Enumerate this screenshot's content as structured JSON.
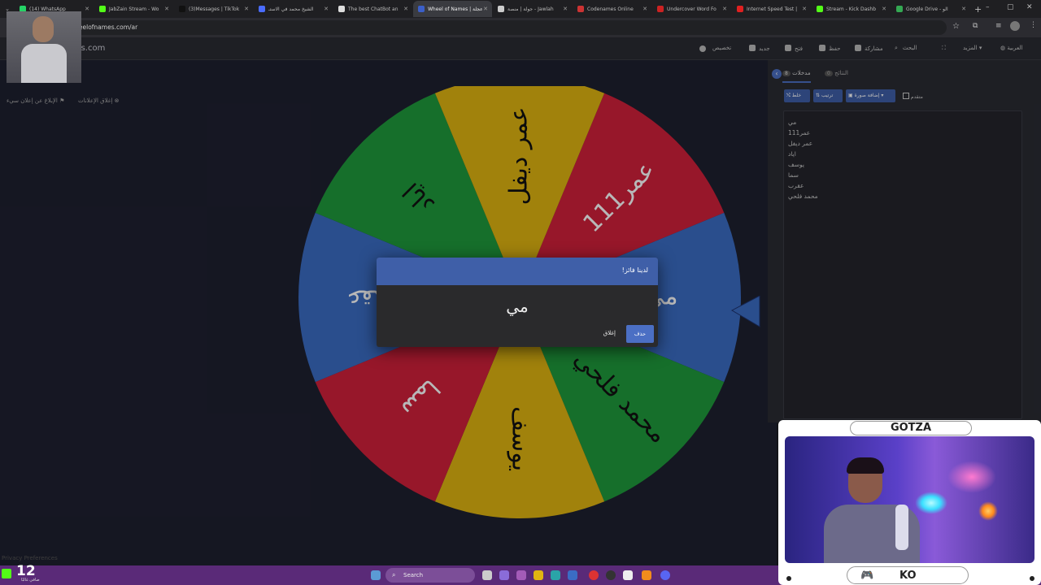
{
  "tabs": [
    {
      "label": "(14) WhatsApp",
      "color": "#25d366"
    },
    {
      "label": "JabZain Stream - Wo",
      "color": "#53fc18"
    },
    {
      "label": "(3)Messages | TikTok",
      "color": "#111111"
    },
    {
      "label": "الشيخ محمد في الاستـ",
      "color": "#4a6cff"
    },
    {
      "label": "The best ChatBot an",
      "color": "#dddddd"
    },
    {
      "label": "Wheel of Names | عجلة",
      "color": "#3b5fc8",
      "active": true
    },
    {
      "label": "جولة | منصة - Jawlah",
      "color": "#cccccc"
    },
    {
      "label": "Codenames Online",
      "color": "#cc3333"
    },
    {
      "label": "Undercover Word Fo",
      "color": "#cc2222"
    },
    {
      "label": "Internet Speed Test |",
      "color": "#e02020"
    },
    {
      "label": "Stream - Kick Dashb",
      "color": "#53fc18"
    },
    {
      "label": "Google Drive - الو",
      "color": "#34a853"
    }
  ],
  "address_bar": {
    "url": "wheelofnames.com/ar"
  },
  "app": {
    "logo_text": "wheelofnames.com",
    "menu": {
      "customize": "تخصيص",
      "new": "جديد",
      "open": "فتح",
      "save": "حفظ",
      "share": "مشاركة",
      "search": "البحث",
      "more": "المزيد",
      "language": "العربية"
    },
    "side_links": {
      "close_ads": "إغلاق الإعلانات",
      "report_ad": "الإبلاغ عن إعلان سيء"
    }
  },
  "wheel": {
    "segments": [
      {
        "label": "عمر111",
        "color": "#d1203b"
      },
      {
        "label": "مي",
        "color": "#3b6cc4"
      },
      {
        "label": "محمد فلحي",
        "color": "#1f9a3c"
      },
      {
        "label": "يوسف",
        "color": "#e0b511"
      },
      {
        "label": "سما",
        "color": "#d1203b"
      },
      {
        "label": "عقرب",
        "color": "#3b6cc4"
      },
      {
        "label": "اياد",
        "color": "#1f9a3c"
      },
      {
        "label": "عمر ديفل",
        "color": "#e0b511"
      }
    ]
  },
  "side_panel": {
    "tab_entries": "مدخلات",
    "tab_entries_count": "8",
    "tab_results": "النتائج",
    "tab_results_count": "0",
    "shuffle": "خلط",
    "sort": "ترتيب",
    "add_image": "إضافة صورة",
    "advanced": "متقدم",
    "entries": [
      "مي",
      "عمر111",
      "عمر ديفل",
      "اياد",
      "يوسف",
      "سما",
      "عقرب",
      "محمد فلحي"
    ]
  },
  "modal": {
    "title": "لدينا فائز!",
    "winner": "مي",
    "remove_label": "حذف",
    "close_label": "إغلاق"
  },
  "footer": {
    "privacy": "Privacy Preferences"
  },
  "taskbar": {
    "temperature": "12",
    "weather": "صافي غالبًا",
    "search_placeholder": "Search"
  },
  "stream_overlay": {
    "top_name": "GOTZA",
    "bottom_label": "KO"
  }
}
